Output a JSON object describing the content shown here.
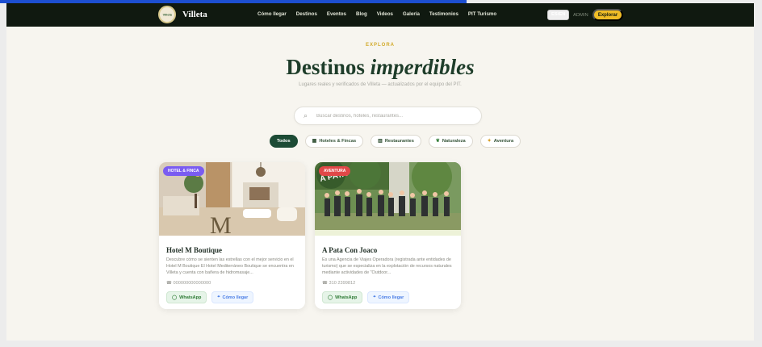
{
  "nav": {
    "brand": "Villeta",
    "logo_text": "Villeta",
    "links": [
      "Cómo llegar",
      "Destinos",
      "Eventos",
      "Blog",
      "Videos",
      "Galería",
      "Testimonios",
      "PIT Turismo"
    ],
    "language": "ES/EN",
    "admin": "ADMIN",
    "cta": "Explorar"
  },
  "hero": {
    "kicker": "EXPLORA",
    "title_main": "Destinos",
    "title_italic": "imperdibles",
    "subtitle": "Lugares reales y verificados de Villeta — actualizados por el equipo del PIT."
  },
  "search": {
    "placeholder": "Buscar destinos, hoteles, restaurantes...",
    "icon": "search-icon"
  },
  "filters": [
    {
      "label": "Todos",
      "icon": "",
      "active": true
    },
    {
      "label": "Hoteles & Fincas",
      "icon": "building-icon",
      "active": false
    },
    {
      "label": "Restaurantes",
      "icon": "restaurant-icon",
      "active": false
    },
    {
      "label": "Naturaleza",
      "icon": "leaf-icon",
      "active": false
    },
    {
      "label": "Aventura",
      "icon": "spark-icon",
      "active": false
    }
  ],
  "cards": [
    {
      "badge": "HOTEL & FINCA",
      "title": "Hotel M Boutique",
      "description": "Descubre cómo se sienten las estrellas con el mejor servicio en el Hotel M Boutique El Hotel Mediterráneo Boutique se encuentra en Villeta y cuenta con bañera de hidromasaje...",
      "phone": "000000000000000",
      "whatsapp": "WhatsApp",
      "directions": "Cómo llegar"
    },
    {
      "badge": "AVENTURA",
      "title": "A Pata Con Joaco",
      "description": "Es una Agencia de Viajes Operadora (registrada ante entidades de turismo) que se especializa en la explotación de recursos naturales mediante actividades de \"Outdoor...",
      "phone": "310 2399812",
      "whatsapp": "WhatsApp",
      "directions": "Cómo llegar"
    }
  ],
  "colors": {
    "nav_bg": "#101910",
    "brand_green": "#1c4b35",
    "gold": "#d2aa2b",
    "cta_yellow": "#f0bd26",
    "badge_purple": "#7a5cf1",
    "badge_red": "#e04848"
  }
}
